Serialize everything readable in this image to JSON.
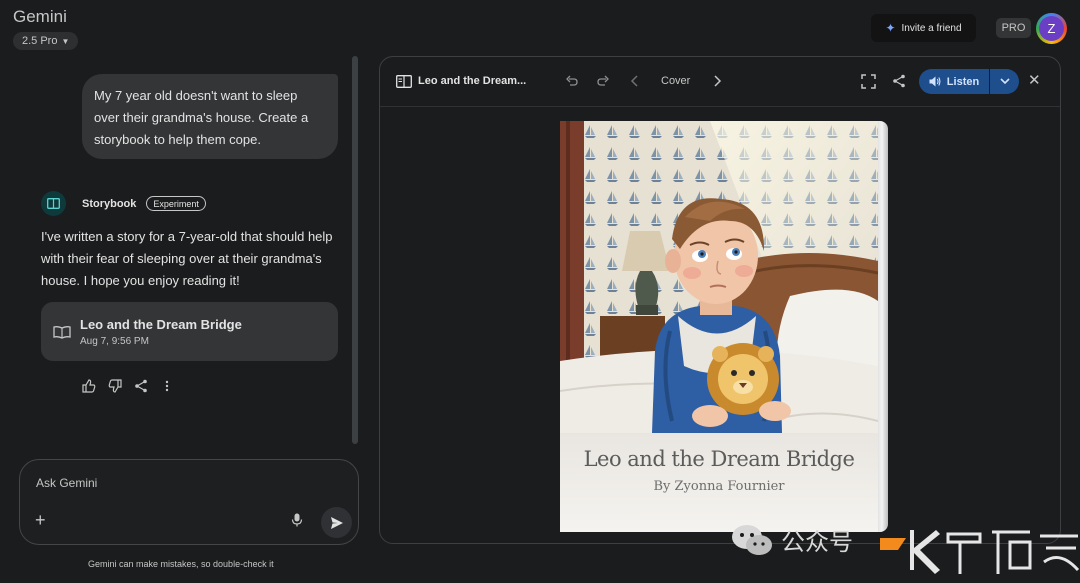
{
  "app": {
    "name": "Gemini",
    "model": "2.5 Pro"
  },
  "top_right": {
    "invite_label": "Invite a friend",
    "pro_label": "PRO",
    "avatar_letter": "Z"
  },
  "chat": {
    "user_message": "My 7 year old doesn't want to sleep over their grandma's house. Create a storybook to help them cope.",
    "agent_name": "Storybook",
    "agent_badge": "Experiment",
    "reply": "I've written a story for a 7-year-old that should help with their fear of sleeping over at their grandma's house. I hope you enjoy reading it!",
    "doc_card": {
      "title": "Leo and the Dream Bridge",
      "date": "Aug 7, 9:56 PM"
    }
  },
  "input": {
    "placeholder": "Ask Gemini",
    "disclaimer": "Gemini can make mistakes, so double-check it"
  },
  "panel": {
    "title": "Leo and the Dream...",
    "page_label": "Cover",
    "listen_label": "Listen",
    "book": {
      "title": "Leo and the Dream Bridge",
      "author": "By Zyonna Fournier"
    }
  },
  "watermark": {
    "text": "公众号"
  },
  "colors": {
    "background": "#1b1c1d",
    "bubble": "#333537",
    "accent": "#1f4e8c",
    "agent_icon": "#0e3a3c"
  }
}
